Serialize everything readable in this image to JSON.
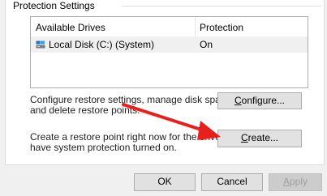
{
  "group": {
    "title": "Protection Settings"
  },
  "drives_table": {
    "columns": [
      "Available Drives",
      "Protection"
    ],
    "rows": [
      {
        "drive": "Local Disk (C:) (System)",
        "protection": "On",
        "icon": "drive-icon"
      }
    ]
  },
  "configure": {
    "description_line1": "Configure restore settings, manage disk space,",
    "description_line2": "and delete restore points.",
    "button_label_underlined": "C",
    "button_label_rest": "onfigure..."
  },
  "create": {
    "description_line1": "Create a restore point right now for the drives that",
    "description_line2": "have system protection turned on.",
    "button_label_underlined": "C",
    "button_label_rest": "reate..."
  },
  "footer": {
    "ok_label": "OK",
    "cancel_label": "Cancel",
    "apply_label_underlined": "A",
    "apply_label_rest": "pply"
  },
  "annotation": {
    "arrow_color": "#e8201c"
  }
}
